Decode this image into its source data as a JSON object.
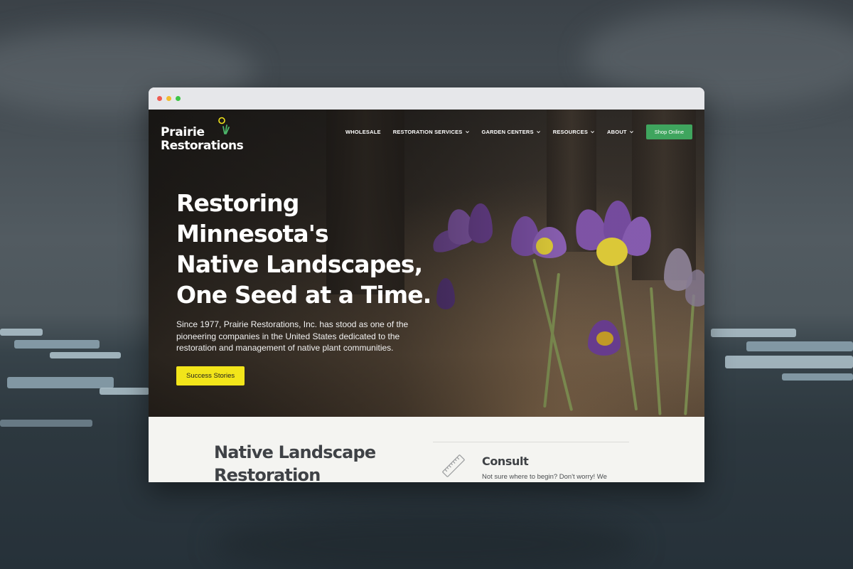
{
  "site": {
    "logo_line1": "Prairie",
    "logo_line2": "Restorations"
  },
  "nav": {
    "items": [
      {
        "label": "WHOLESALE",
        "dropdown": false
      },
      {
        "label": "RESTORATION SERVICES",
        "dropdown": true
      },
      {
        "label": "GARDEN CENTERS",
        "dropdown": true
      },
      {
        "label": "RESOURCES",
        "dropdown": true
      },
      {
        "label": "ABOUT",
        "dropdown": true
      }
    ],
    "shop_label": "Shop Online"
  },
  "hero": {
    "title_lines": [
      "Restoring Minnesota's",
      "Native Landscapes,",
      "One Seed at a Time."
    ],
    "subtitle": "Since 1977, Prairie Restorations, Inc. has stood as one of the pioneering companies in the United States dedicated to the restoration and management of native plant communities.",
    "cta_label": "Success Stories"
  },
  "section": {
    "heading": "Native Landscape Restoration",
    "consult_title": "Consult",
    "consult_text": "Not sure where to begin? Don't worry! We"
  },
  "colors": {
    "shop_button": "#3fa55e",
    "cta_button": "#f2e51a",
    "text_dark": "#3f4246"
  },
  "icons": [
    "chevron-down-icon",
    "ruler-icon",
    "logo-leaf-icon"
  ]
}
